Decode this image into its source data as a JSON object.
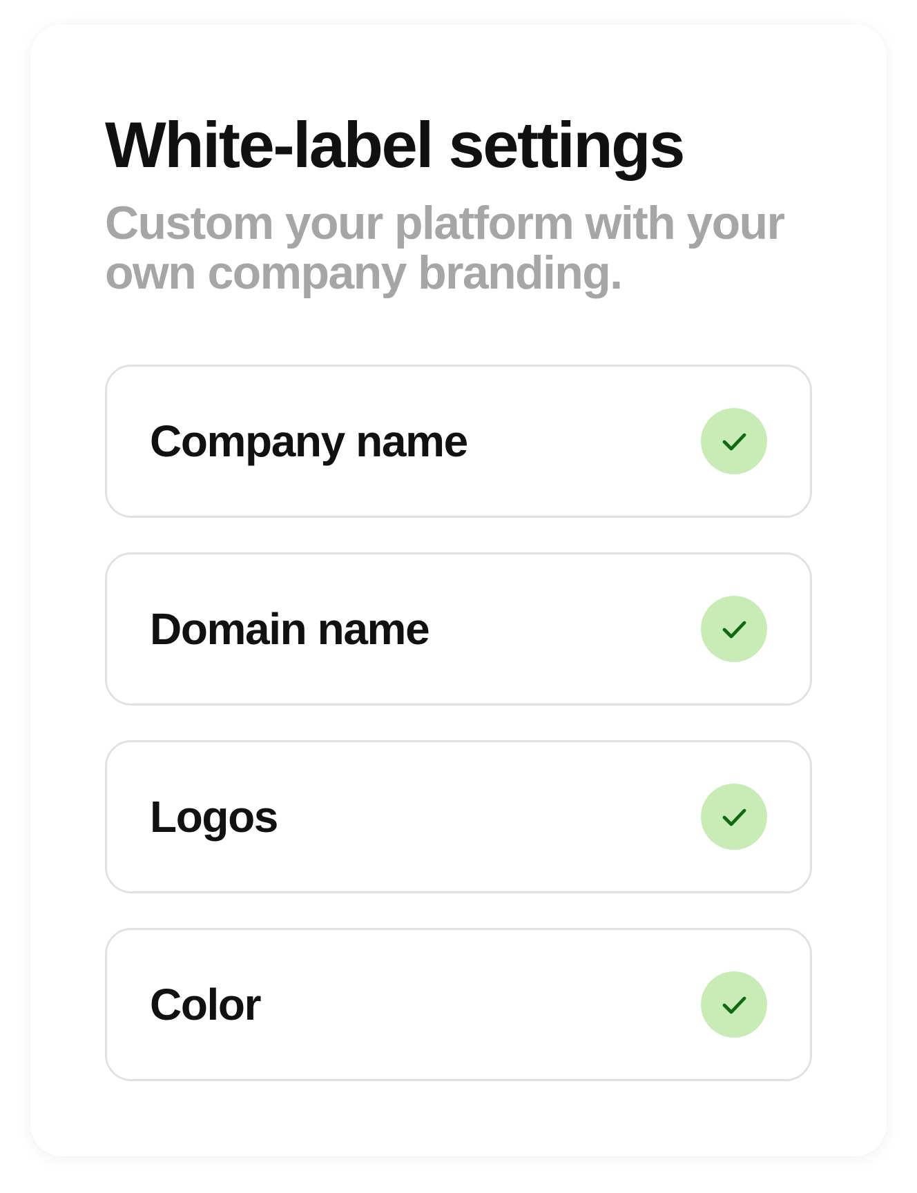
{
  "header": {
    "title": "White-label settings",
    "subtitle": "Custom your platform with your own company branding."
  },
  "items": [
    {
      "label": "Company name",
      "icon": "check-icon",
      "checked": true
    },
    {
      "label": "Domain name",
      "icon": "check-icon",
      "checked": true
    },
    {
      "label": "Logos",
      "icon": "check-icon",
      "checked": true
    },
    {
      "label": "Color",
      "icon": "check-icon",
      "checked": true
    }
  ],
  "colors": {
    "check_background": "#c9ecb7",
    "check_mark": "#0f6a12",
    "title": "#111111",
    "subtitle": "#a6a6a6",
    "item_border": "#e2e2e2"
  }
}
